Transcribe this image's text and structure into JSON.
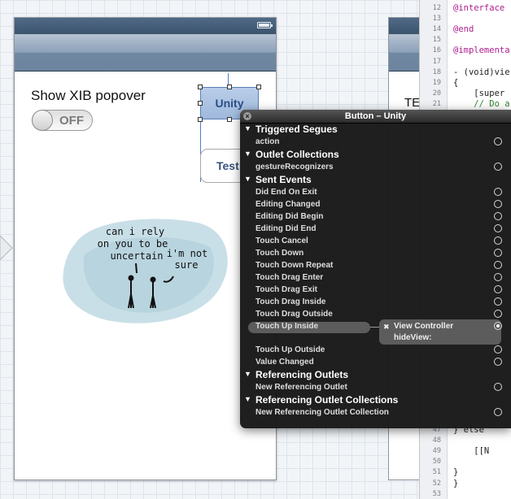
{
  "left_view": {
    "label_text": "Show XIB popover",
    "switch_text": "OFF",
    "unity_button": "Unity",
    "test_button": "Test",
    "doodle": {
      "speech_left": [
        "can i rely",
        "on you to be",
        "uncertain"
      ],
      "speech_right": [
        "i'm not",
        "sure"
      ]
    }
  },
  "second_view": {
    "label_text": "TE"
  },
  "code": {
    "lines": [
      {
        "n": "12",
        "text": "@interface"
      },
      {
        "n": "13",
        "text": ""
      },
      {
        "n": "14",
        "text": "@end"
      },
      {
        "n": "15",
        "text": ""
      },
      {
        "n": "16",
        "text": "@implementa"
      },
      {
        "n": "17",
        "text": ""
      },
      {
        "n": "18",
        "text": "- (void)vie"
      },
      {
        "n": "19",
        "text": "{"
      },
      {
        "n": "20",
        "text": "    [super"
      },
      {
        "n": "21",
        "text": "    // Do a"
      }
    ],
    "lower_lines": [
      {
        "n": "47",
        "text": "} else"
      },
      {
        "n": "48",
        "text": ""
      },
      {
        "n": "49",
        "text": "    [[N"
      },
      {
        "n": "50",
        "text": ""
      },
      {
        "n": "51",
        "text": "}"
      },
      {
        "n": "52",
        "text": "}"
      },
      {
        "n": "53",
        "text": ""
      }
    ]
  },
  "panel": {
    "title": "Button – Unity",
    "sections": [
      {
        "title": "Triggered Segues",
        "rows": [
          "action"
        ]
      },
      {
        "title": "Outlet Collections",
        "rows": [
          "gestureRecognizers"
        ]
      },
      {
        "title": "Sent Events",
        "rows": [
          "Did End On Exit",
          "Editing Changed",
          "Editing Did Begin",
          "Editing Did End",
          "Touch Cancel",
          "Touch Down",
          "Touch Down Repeat",
          "Touch Drag Enter",
          "Touch Drag Exit",
          "Touch Drag Inside",
          "Touch Drag Outside",
          "Touch Up Inside",
          "Touch Up Outside",
          "Value Changed"
        ]
      },
      {
        "title": "Referencing Outlets",
        "rows": [
          "New Referencing Outlet"
        ]
      },
      {
        "title": "Referencing Outlet Collections",
        "rows": [
          "New Referencing Outlet Collection"
        ]
      }
    ],
    "connection": {
      "target": "View Controller",
      "method": "hideView:",
      "remove_glyph": "✖"
    }
  },
  "colors": {
    "panel_bg": "#161616",
    "selected_button": "#a9c2e2",
    "keyword": "#ac1c8f",
    "comment": "#2f7f2d"
  }
}
